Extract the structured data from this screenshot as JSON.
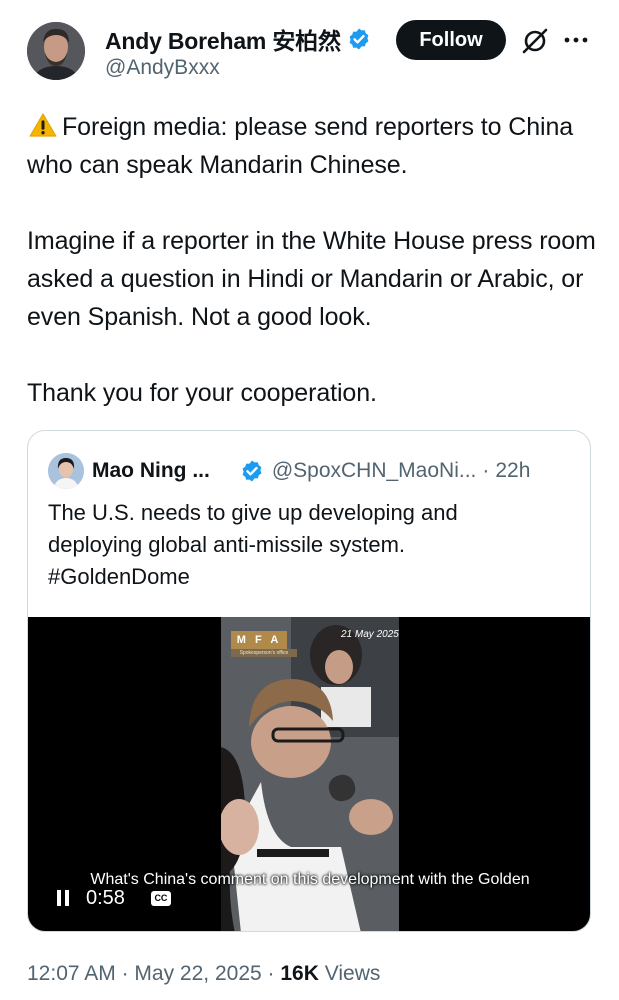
{
  "author": {
    "display_name": "Andy Boreham 安柏然",
    "handle": "@AndyBxxx",
    "verified": true
  },
  "actions": {
    "follow_label": "Follow",
    "grok_icon": "grok-icon",
    "more_icon": "more-options-icon"
  },
  "tweet": {
    "warning_icon": "warning-emoji",
    "paragraphs": [
      "Foreign media: please send reporters to China who can speak Mandarin Chinese.",
      "Imagine if a reporter in the White House press room asked a question in Hindi or Mandarin or Arabic, or even Spanish. Not a good look.",
      "Thank you for your cooperation."
    ]
  },
  "quoted_tweet": {
    "display_name": "Mao Ning ...",
    "handle": "@SpoxCHN_MaoNi...",
    "separator": "·",
    "time": "22h",
    "text_lines": [
      "The U.S. needs to give up developing and",
      "deploying global anti-missile system.",
      "#GoldenDome"
    ],
    "video": {
      "badge": "M F A",
      "badge_sub": "Spokesperson's office",
      "date_stamp": "21 May 2025",
      "subtitle": "What's China's comment on this development with the Golden",
      "elapsed": "0:58",
      "cc_label": "CC"
    }
  },
  "meta": {
    "time": "12:07 AM",
    "separator": "·",
    "date": "May 22, 2025",
    "views_count": "16K",
    "views_label": "Views"
  },
  "colors": {
    "text": "#0f1419",
    "secondary": "#536471",
    "verified": "#1d9bf0",
    "border": "#cfd9de",
    "follow_bg": "#0f1419"
  }
}
